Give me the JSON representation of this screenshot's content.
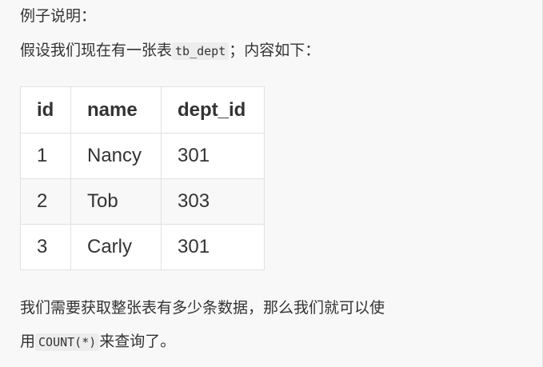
{
  "intro": {
    "heading": "例子说明：",
    "assume_prefix": "假设我们现在有一张表",
    "table_name_code": "tb_dept",
    "assume_suffix": "；内容如下："
  },
  "table": {
    "headers": [
      "id",
      "name",
      "dept_id"
    ],
    "rows": [
      [
        "1",
        "Nancy",
        "301"
      ],
      [
        "2",
        "Tob",
        "303"
      ],
      [
        "3",
        "Carly",
        "301"
      ]
    ]
  },
  "explanation": {
    "line1": "我们需要获取整张表有多少条数据，那么我们就可以使",
    "line2_prefix": "用",
    "count_code": "COUNT(*)",
    "line2_suffix": "来查询了。"
  }
}
